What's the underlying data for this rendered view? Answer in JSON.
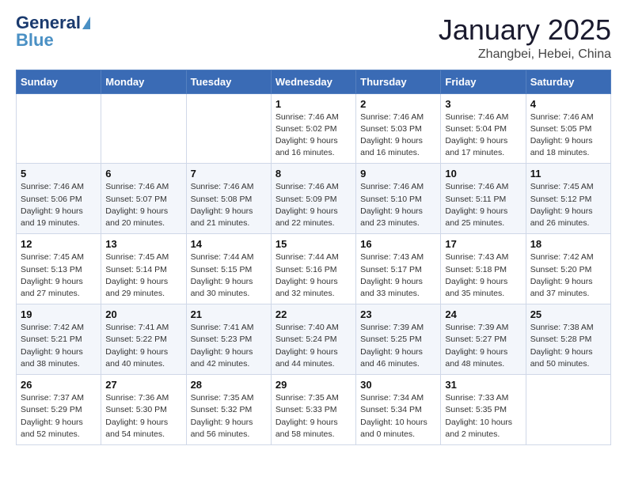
{
  "header": {
    "logo_general": "General",
    "logo_blue": "Blue",
    "month": "January 2025",
    "location": "Zhangbei, Hebei, China"
  },
  "days_of_week": [
    "Sunday",
    "Monday",
    "Tuesday",
    "Wednesday",
    "Thursday",
    "Friday",
    "Saturday"
  ],
  "weeks": [
    [
      {
        "day": "",
        "sunrise": "",
        "sunset": "",
        "daylight": ""
      },
      {
        "day": "",
        "sunrise": "",
        "sunset": "",
        "daylight": ""
      },
      {
        "day": "",
        "sunrise": "",
        "sunset": "",
        "daylight": ""
      },
      {
        "day": "1",
        "sunrise": "Sunrise: 7:46 AM",
        "sunset": "Sunset: 5:02 PM",
        "daylight": "Daylight: 9 hours and 16 minutes."
      },
      {
        "day": "2",
        "sunrise": "Sunrise: 7:46 AM",
        "sunset": "Sunset: 5:03 PM",
        "daylight": "Daylight: 9 hours and 16 minutes."
      },
      {
        "day": "3",
        "sunrise": "Sunrise: 7:46 AM",
        "sunset": "Sunset: 5:04 PM",
        "daylight": "Daylight: 9 hours and 17 minutes."
      },
      {
        "day": "4",
        "sunrise": "Sunrise: 7:46 AM",
        "sunset": "Sunset: 5:05 PM",
        "daylight": "Daylight: 9 hours and 18 minutes."
      }
    ],
    [
      {
        "day": "5",
        "sunrise": "Sunrise: 7:46 AM",
        "sunset": "Sunset: 5:06 PM",
        "daylight": "Daylight: 9 hours and 19 minutes."
      },
      {
        "day": "6",
        "sunrise": "Sunrise: 7:46 AM",
        "sunset": "Sunset: 5:07 PM",
        "daylight": "Daylight: 9 hours and 20 minutes."
      },
      {
        "day": "7",
        "sunrise": "Sunrise: 7:46 AM",
        "sunset": "Sunset: 5:08 PM",
        "daylight": "Daylight: 9 hours and 21 minutes."
      },
      {
        "day": "8",
        "sunrise": "Sunrise: 7:46 AM",
        "sunset": "Sunset: 5:09 PM",
        "daylight": "Daylight: 9 hours and 22 minutes."
      },
      {
        "day": "9",
        "sunrise": "Sunrise: 7:46 AM",
        "sunset": "Sunset: 5:10 PM",
        "daylight": "Daylight: 9 hours and 23 minutes."
      },
      {
        "day": "10",
        "sunrise": "Sunrise: 7:46 AM",
        "sunset": "Sunset: 5:11 PM",
        "daylight": "Daylight: 9 hours and 25 minutes."
      },
      {
        "day": "11",
        "sunrise": "Sunrise: 7:45 AM",
        "sunset": "Sunset: 5:12 PM",
        "daylight": "Daylight: 9 hours and 26 minutes."
      }
    ],
    [
      {
        "day": "12",
        "sunrise": "Sunrise: 7:45 AM",
        "sunset": "Sunset: 5:13 PM",
        "daylight": "Daylight: 9 hours and 27 minutes."
      },
      {
        "day": "13",
        "sunrise": "Sunrise: 7:45 AM",
        "sunset": "Sunset: 5:14 PM",
        "daylight": "Daylight: 9 hours and 29 minutes."
      },
      {
        "day": "14",
        "sunrise": "Sunrise: 7:44 AM",
        "sunset": "Sunset: 5:15 PM",
        "daylight": "Daylight: 9 hours and 30 minutes."
      },
      {
        "day": "15",
        "sunrise": "Sunrise: 7:44 AM",
        "sunset": "Sunset: 5:16 PM",
        "daylight": "Daylight: 9 hours and 32 minutes."
      },
      {
        "day": "16",
        "sunrise": "Sunrise: 7:43 AM",
        "sunset": "Sunset: 5:17 PM",
        "daylight": "Daylight: 9 hours and 33 minutes."
      },
      {
        "day": "17",
        "sunrise": "Sunrise: 7:43 AM",
        "sunset": "Sunset: 5:18 PM",
        "daylight": "Daylight: 9 hours and 35 minutes."
      },
      {
        "day": "18",
        "sunrise": "Sunrise: 7:42 AM",
        "sunset": "Sunset: 5:20 PM",
        "daylight": "Daylight: 9 hours and 37 minutes."
      }
    ],
    [
      {
        "day": "19",
        "sunrise": "Sunrise: 7:42 AM",
        "sunset": "Sunset: 5:21 PM",
        "daylight": "Daylight: 9 hours and 38 minutes."
      },
      {
        "day": "20",
        "sunrise": "Sunrise: 7:41 AM",
        "sunset": "Sunset: 5:22 PM",
        "daylight": "Daylight: 9 hours and 40 minutes."
      },
      {
        "day": "21",
        "sunrise": "Sunrise: 7:41 AM",
        "sunset": "Sunset: 5:23 PM",
        "daylight": "Daylight: 9 hours and 42 minutes."
      },
      {
        "day": "22",
        "sunrise": "Sunrise: 7:40 AM",
        "sunset": "Sunset: 5:24 PM",
        "daylight": "Daylight: 9 hours and 44 minutes."
      },
      {
        "day": "23",
        "sunrise": "Sunrise: 7:39 AM",
        "sunset": "Sunset: 5:25 PM",
        "daylight": "Daylight: 9 hours and 46 minutes."
      },
      {
        "day": "24",
        "sunrise": "Sunrise: 7:39 AM",
        "sunset": "Sunset: 5:27 PM",
        "daylight": "Daylight: 9 hours and 48 minutes."
      },
      {
        "day": "25",
        "sunrise": "Sunrise: 7:38 AM",
        "sunset": "Sunset: 5:28 PM",
        "daylight": "Daylight: 9 hours and 50 minutes."
      }
    ],
    [
      {
        "day": "26",
        "sunrise": "Sunrise: 7:37 AM",
        "sunset": "Sunset: 5:29 PM",
        "daylight": "Daylight: 9 hours and 52 minutes."
      },
      {
        "day": "27",
        "sunrise": "Sunrise: 7:36 AM",
        "sunset": "Sunset: 5:30 PM",
        "daylight": "Daylight: 9 hours and 54 minutes."
      },
      {
        "day": "28",
        "sunrise": "Sunrise: 7:35 AM",
        "sunset": "Sunset: 5:32 PM",
        "daylight": "Daylight: 9 hours and 56 minutes."
      },
      {
        "day": "29",
        "sunrise": "Sunrise: 7:35 AM",
        "sunset": "Sunset: 5:33 PM",
        "daylight": "Daylight: 9 hours and 58 minutes."
      },
      {
        "day": "30",
        "sunrise": "Sunrise: 7:34 AM",
        "sunset": "Sunset: 5:34 PM",
        "daylight": "Daylight: 10 hours and 0 minutes."
      },
      {
        "day": "31",
        "sunrise": "Sunrise: 7:33 AM",
        "sunset": "Sunset: 5:35 PM",
        "daylight": "Daylight: 10 hours and 2 minutes."
      },
      {
        "day": "",
        "sunrise": "",
        "sunset": "",
        "daylight": ""
      }
    ]
  ]
}
